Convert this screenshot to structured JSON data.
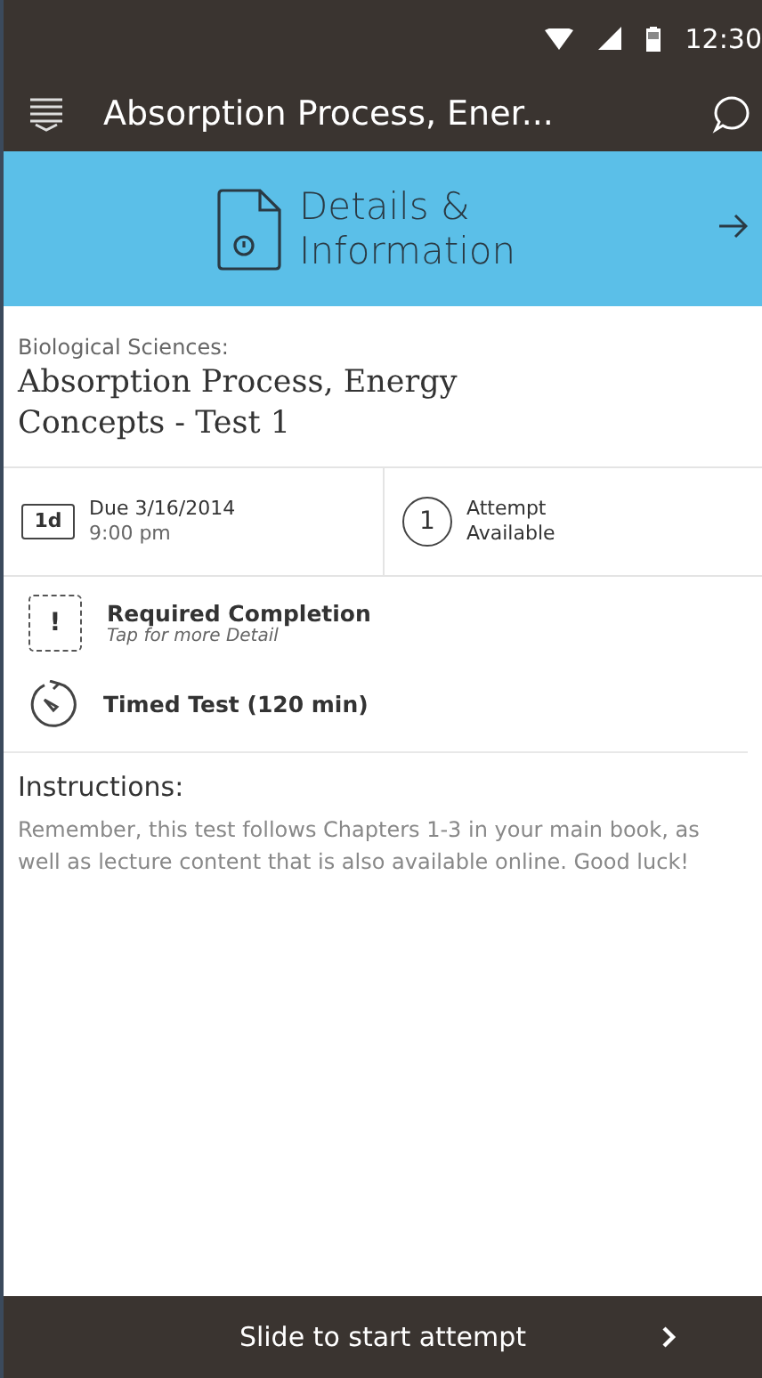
{
  "status_bar": {
    "time": "12:30"
  },
  "app_bar": {
    "title": "Absorption Process, Ener..."
  },
  "banner": {
    "title": "Details & Information"
  },
  "header": {
    "course": "Biological Sciences:",
    "title": "Absorption Process, Energy Concepts - Test 1"
  },
  "due": {
    "badge": "1d",
    "date": "Due 3/16/2014",
    "time": "9:00 pm"
  },
  "attempts": {
    "count": "1",
    "label": "Attempt Available"
  },
  "requirements": [
    {
      "kind": "required",
      "mark": "!",
      "title": "Required Completion",
      "hint": "Tap for more Detail"
    },
    {
      "kind": "timed",
      "title": "Timed Test (120 min)"
    }
  ],
  "instructions": {
    "heading": "Instructions:",
    "body": "Remember, this test follows Chapters 1-3 in your main book, as well as lecture content that is also available online. Good luck!"
  },
  "footer": {
    "label": "Slide to start attempt"
  }
}
